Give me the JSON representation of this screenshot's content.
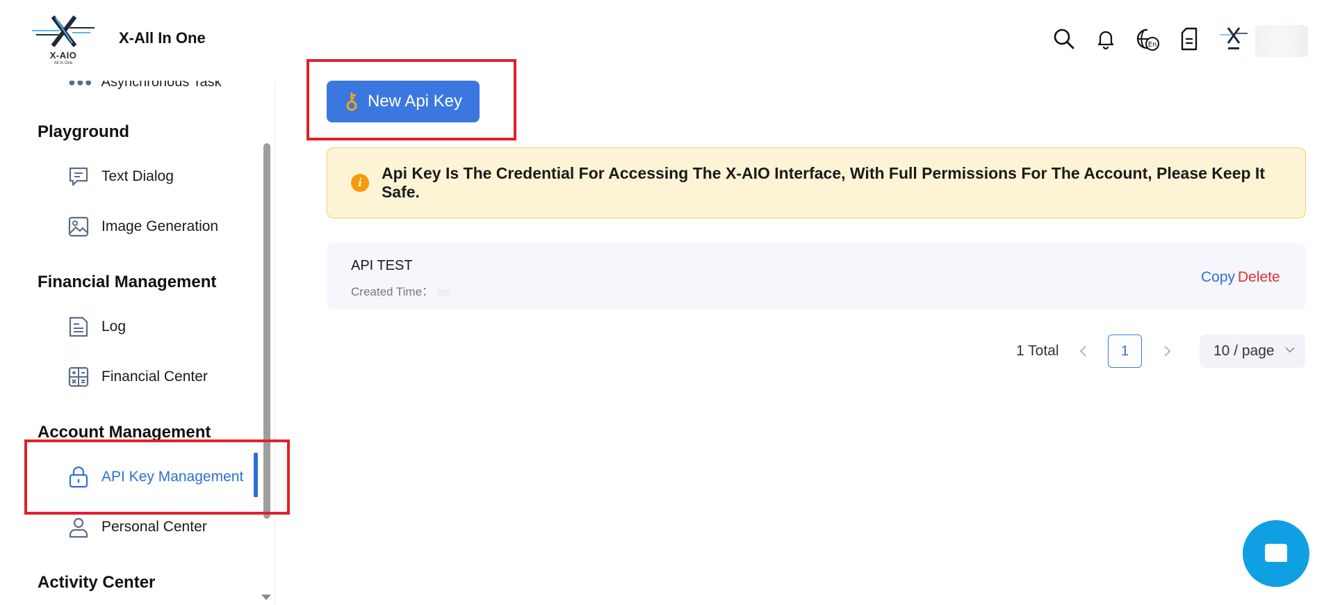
{
  "header": {
    "logo_text": "X-AIO",
    "logo_sub": "All In One",
    "app_title": "X-All In One"
  },
  "sidebar": {
    "cut_item_label": "Asynchronous Task",
    "groups": [
      {
        "title": "Playground",
        "items": [
          {
            "label": "Text Dialog",
            "icon": "chat-icon"
          },
          {
            "label": "Image Generation",
            "icon": "image-icon"
          }
        ]
      },
      {
        "title": "Financial Management",
        "items": [
          {
            "label": "Log",
            "icon": "document-icon"
          },
          {
            "label": "Financial Center",
            "icon": "calculator-icon"
          }
        ]
      },
      {
        "title": "Account Management",
        "items": [
          {
            "label": "API Key Management",
            "icon": "lock-icon",
            "active": true
          },
          {
            "label": "Personal Center",
            "icon": "user-icon"
          }
        ]
      },
      {
        "title": "Activity Center",
        "items": []
      }
    ]
  },
  "main": {
    "new_key_button": "New Api Key",
    "notice": "Api Key Is The Credential For Accessing The X-AIO Interface, With Full Permissions For The Account, Please Keep It Safe.",
    "keys": [
      {
        "name": "API TEST",
        "created_label": "Created Time：",
        "copy_label": "Copy",
        "delete_label": "Delete"
      }
    ],
    "pagination": {
      "total_text": "1 Total",
      "current_page": "1",
      "page_size": "10 / page"
    }
  },
  "colors": {
    "accent": "#3a78e0",
    "highlight_box": "#e0202c",
    "notice_bg": "#fdf4d6",
    "delete": "#e0302e",
    "chat_fab": "#0f9fe3"
  }
}
